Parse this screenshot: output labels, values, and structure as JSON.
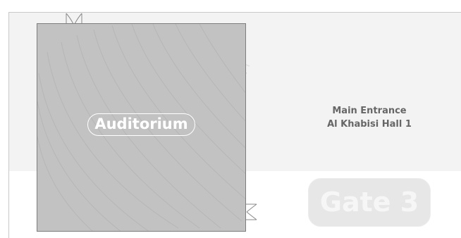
{
  "map": {
    "rooms": {
      "auditorium": {
        "label": "Auditorium"
      }
    },
    "entrance": {
      "line1": "Main Entrance",
      "line2": "Al Khabisi Hall 1"
    },
    "gate": {
      "label": "Gate 3"
    },
    "icons": {
      "door_top": "door-swing-icon",
      "door_right": "door-swing-icon"
    },
    "colors": {
      "floor": "#f3f3f3",
      "auditorium_fill": "#c2c2c2",
      "auditorium_border": "#7d7d7d",
      "entrance_text": "#666666",
      "gate_fill": "#e7e7e7",
      "wall": "#c9c9c9"
    }
  }
}
